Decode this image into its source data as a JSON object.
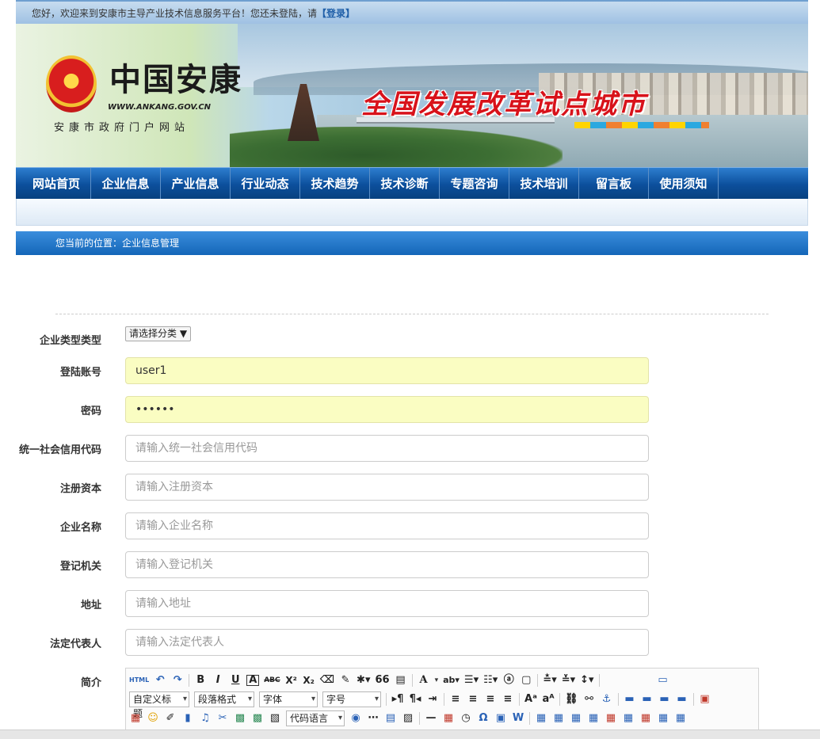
{
  "topbar": {
    "welcome": "您好，欢迎来到安康市主导产业技术信息服务平台！您还未登陆，请",
    "login": "【登录】"
  },
  "banner": {
    "logo_text": "中国安康",
    "logo_url": "WWW.ANKANG.GOV.CN",
    "logo_sub": "安康市政府门户网站",
    "slogan": "全国发展改革试点城市"
  },
  "nav": {
    "items": [
      "网站首页",
      "企业信息",
      "产业信息",
      "行业动态",
      "技术趋势",
      "技术诊断",
      "专题咨询",
      "技术培训",
      "留言板",
      "使用须知"
    ]
  },
  "breadcrumb": "您当前的位置：企业信息管理",
  "form": {
    "category_label": "企业类型类型",
    "category_value": "请选择分类",
    "account_label": "登陆账号",
    "account_value": "user1",
    "password_label": "密码",
    "password_value": "••••••",
    "credit_label": "统一社会信用代码",
    "credit_placeholder": "请输入统一社会信用代码",
    "capital_label": "注册资本",
    "capital_placeholder": "请输入注册资本",
    "name_label": "企业名称",
    "name_placeholder": "请输入企业名称",
    "authority_label": "登记机关",
    "authority_placeholder": "请输入登记机关",
    "address_label": "地址",
    "address_placeholder": "请输入地址",
    "rep_label": "法定代表人",
    "rep_placeholder": "请输入法定代表人",
    "intro_label": "简介"
  },
  "editor": {
    "dropdowns": {
      "heading": "自定义标题",
      "paragraph": "段落格式",
      "font": "字体",
      "size": "字号",
      "code": "代码语言"
    },
    "row1": {
      "html": "HTML",
      "bold": "B",
      "italic": "I",
      "underline": "U",
      "fontborder": "A",
      "strike": "ABC",
      "sup": "X²",
      "sub": "X₂",
      "quote": "66",
      "forecolor": "A",
      "omega": "Ω"
    }
  }
}
